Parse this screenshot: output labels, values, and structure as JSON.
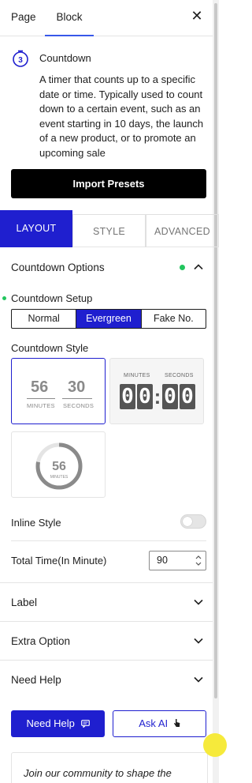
{
  "tabs": {
    "page": "Page",
    "block": "Block"
  },
  "block": {
    "title": "Countdown",
    "description": "A timer that counts up to a specific date or time. Typically used to count down to a certain event, such as an event starting in 10 days, the launch of a new product, or to promote an upcoming sale"
  },
  "import_presets_label": "Import Presets",
  "section_tabs": {
    "layout": "LAYOUT",
    "style": "STYLE",
    "advanced": "ADVANCED"
  },
  "countdown_options": {
    "heading": "Countdown Options",
    "setup_label": "Countdown Setup",
    "setup_options": [
      "Normal",
      "Evergreen",
      "Fake No."
    ],
    "setup_selected": "Evergreen",
    "style_label": "Countdown Style",
    "style1": {
      "minutes": "56",
      "seconds": "30",
      "minutes_cap": "MINUTES",
      "seconds_cap": "SECONDS"
    },
    "style2": {
      "minutes_cap": "MINUTES",
      "seconds_cap": "SECONDS",
      "digits": [
        "0",
        "0",
        "0",
        "0"
      ],
      "colon": ":"
    },
    "style3": {
      "value": "56",
      "cap": "MINUTES",
      "ring_fraction": 0.78
    },
    "inline_style_label": "Inline Style",
    "inline_style_on": false,
    "total_time_label": "Total Time(In Minute)",
    "total_time_value": "90"
  },
  "panels": {
    "label": "Label",
    "extra_option": "Extra Option",
    "need_help": "Need Help"
  },
  "buttons": {
    "need_help": "Need Help",
    "ask_ai": "Ask AI"
  },
  "community_text": "Join our community to shape the",
  "colors": {
    "accent": "#1f1fcf",
    "tab_underline": "#3858e9",
    "status_dot": "#22c55e"
  }
}
